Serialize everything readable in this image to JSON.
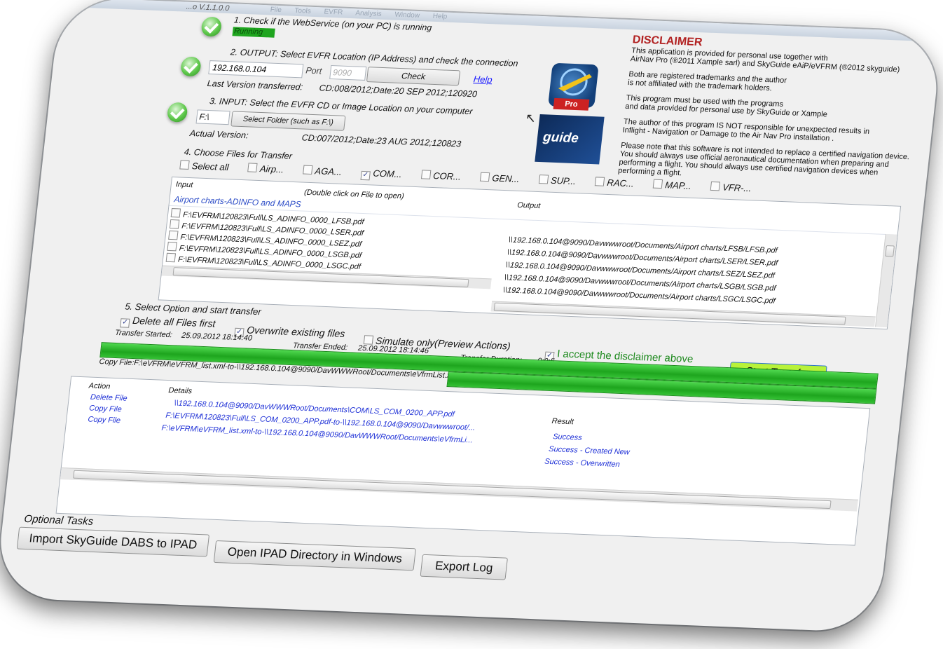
{
  "window": {
    "title": "...o V.1.1.0.0",
    "menu": [
      "File",
      "Tools",
      "EVFR",
      "Analysis",
      "Window",
      "Help"
    ]
  },
  "step1": {
    "label": "1. Check if the WebService (on your PC) is running",
    "status": "Running",
    "status_color": "#1fa51f"
  },
  "step2": {
    "label": "2. OUTPUT: Select EVFR Location (IP Address) and check the connection",
    "ip": "192.168.0.104",
    "port_label": "Port",
    "port_placeholder": "9090",
    "check_button": "Check",
    "help_link": "Help",
    "last_version_label": "Last Version transferred:",
    "last_version_value": "CD:008/2012;Date:20 SEP 2012;120920"
  },
  "step3": {
    "label": "3. INPUT: Select the EVFR CD or Image Location on your computer",
    "folder": "F:\\",
    "select_button": "Select Folder (such as F:\\)",
    "actual_label": "Actual Version:",
    "actual_value": "CD:007/2012;Date:23 AUG 2012;120823"
  },
  "step4": {
    "label": "4. Choose Files for Transfer",
    "filters": [
      {
        "label": "Select all",
        "checked": false
      },
      {
        "label": "Airp...",
        "checked": false
      },
      {
        "label": "AGA...",
        "checked": false
      },
      {
        "label": "COM...",
        "checked": true
      },
      {
        "label": "COR...",
        "checked": false
      },
      {
        "label": "GEN...",
        "checked": false
      },
      {
        "label": "SUP...",
        "checked": false
      },
      {
        "label": "RAC...",
        "checked": false
      },
      {
        "label": "MAP...",
        "checked": false
      },
      {
        "label": "VFR-...",
        "checked": false
      }
    ],
    "col_input": "Input",
    "col_hint": "(Double click on File to open)",
    "col_output": "Output",
    "group": "Airport charts-ADINFO and MAPS",
    "files": [
      {
        "in": "F:\\EVFRM\\120823\\Full\\LS_ADINFO_0000_LFSB.pdf",
        "out": "\\\\192.168.0.104@9090/Davwwwroot/Documents/Airport charts/LFSB/LFSB.pdf"
      },
      {
        "in": "F:\\EVFRM\\120823\\Full\\LS_ADINFO_0000_LSER.pdf",
        "out": "\\\\192.168.0.104@9090/Davwwwroot/Documents/Airport charts/LSER/LSER.pdf"
      },
      {
        "in": "F:\\EVFRM\\120823\\Full\\LS_ADINFO_0000_LSEZ.pdf",
        "out": "\\\\192.168.0.104@9090/Davwwwroot/Documents/Airport charts/LSEZ/LSEZ.pdf"
      },
      {
        "in": "F:\\EVFRM\\120823\\Full\\LS_ADINFO_0000_LSGB.pdf",
        "out": "\\\\192.168.0.104@9090/Davwwwroot/Documents/Airport charts/LSGB/LSGB.pdf"
      },
      {
        "in": "F:\\EVFRM\\120823\\Full\\LS_ADINFO_0000_LSGC.pdf",
        "out": "\\\\192.168.0.104@9090/Davwwwroot/Documents/Airport charts/LSGC/LSGC.pdf"
      }
    ]
  },
  "step5": {
    "label": "5. Select Option and start transfer",
    "opt_delete": "Delete all Files first",
    "opt_overwrite": "Overwrite existing files",
    "opt_simulate": "Simulate only(Preview Actions)",
    "opt_accept": "I accept the disclaimer above",
    "start_button": "Start Transfer",
    "started_label": "Transfer Started:",
    "started_value": "25.09.2012 18:14:40",
    "ended_label": "Transfer Ended:",
    "ended_value": "25.09.2012 18:14:46",
    "duration_label": "Transfer Duration:",
    "duration_value": "0:0:5",
    "progress_percent": 100
  },
  "copy_status": "Copy File:F:\\eVFRM\\eVFRM_list.xml-to-\\\\192.168.0.104@9090/DavWWWRoot/Documents\\eVfrmList.xml",
  "log": {
    "col_action": "Action",
    "col_details": "Details",
    "col_result": "Result",
    "rows": [
      {
        "action": "Delete File",
        "details": "\\\\192.168.0.104@9090/DavWWWRoot/Documents\\COM\\LS_COM_0200_APP.pdf",
        "result": "Success"
      },
      {
        "action": "Copy File",
        "details": "F:\\EVFRM\\120823\\Full\\LS_COM_0200_APP.pdf-to-\\\\192.168.0.104@9090/Davwwwroot/...",
        "result": "Success - Created New"
      },
      {
        "action": "Copy File",
        "details": "F:\\eVFRM\\eVFRM_list.xml-to-\\\\192.168.0.104@9090/DavWWWRoot/Documents\\eVfrmLi...",
        "result": "Success - Overwritten"
      }
    ]
  },
  "optional": {
    "label": "Optional Tasks",
    "import_button": "Import SkyGuide DABS to IPAD",
    "open_button": "Open IPAD Directory in Windows",
    "export_button": "Export Log"
  },
  "disclaimer": {
    "title": "DISCLAIMER",
    "lines": [
      "This application is provided for personal use together with",
      "AirNav Pro (®2011 Xample sarl) and SkyGuide eAiP/eVFRM (®2012 skyguide)",
      "Both are registered trademarks and the author",
      "is not affiliated with the trademark holders.",
      "This  program must be used with the programs",
      "and data provided for personal use by SkyGuide or Xample",
      "The author of this program IS NOT responsible for unexpected results in",
      "Inflight - Navigation or Damage  to the Air Nav Pro installation .",
      "Please note that this software is not intended to replace a certified navigation device.",
      "You should always use official aeronautical documentation when preparing and",
      "performing a flight. You should always use certified navigation devices when",
      "performing a flight."
    ]
  },
  "logos": {
    "airnav_badge": "Pro",
    "skyguide_text": "guide"
  }
}
